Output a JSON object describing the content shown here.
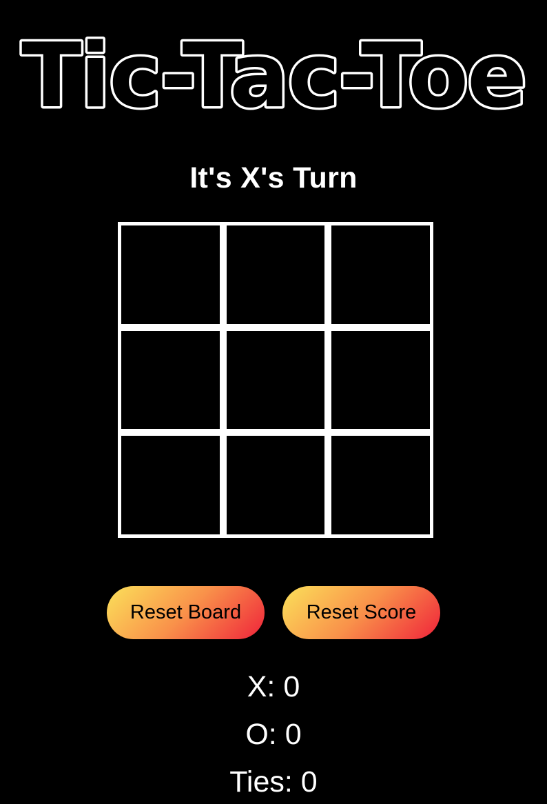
{
  "title": "Tic-Tac-Toe",
  "status": {
    "turn_text": "It's X's Turn"
  },
  "board": {
    "cells": [
      "",
      "",
      "",
      "",
      "",
      "",
      "",
      "",
      ""
    ]
  },
  "buttons": {
    "reset_board": "Reset Board",
    "reset_score": "Reset Score"
  },
  "scores": {
    "x": "X: 0",
    "o": "O: 0",
    "ties": "Ties: 0"
  },
  "colors": {
    "background": "#000000",
    "foreground": "#ffffff",
    "button_gradient_start": "#fbe15a",
    "button_gradient_mid": "#f9914a",
    "button_gradient_end": "#ef233a"
  }
}
